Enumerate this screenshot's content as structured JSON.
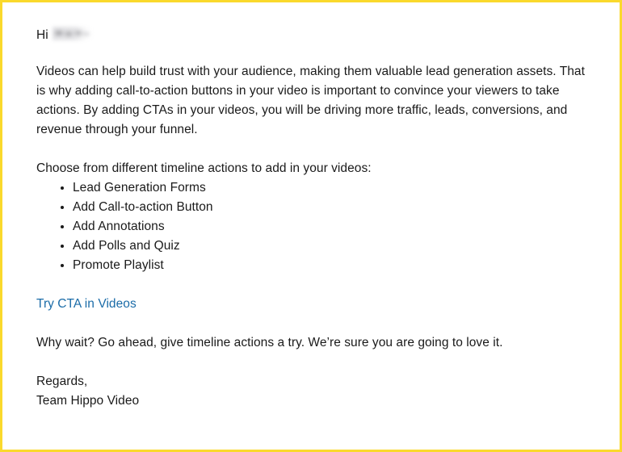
{
  "frame": {
    "border_color": "#fad92c",
    "background_color": "#ffffff",
    "text_color": "#1a1a1a"
  },
  "email": {
    "greeting": {
      "salutation": "Hi",
      "recipient_name_redacted": true
    },
    "body_paragraph": "Videos can help build trust with your audience, making them valuable lead generation assets. That is why adding call-to-action buttons in your video is important to convince your viewers to take actions. By adding CTAs in your videos, you will be driving more traffic, leads, conversions, and revenue through your funnel.",
    "list_intro": "Choose from different timeline actions to add in your videos:",
    "action_items": [
      "Lead Generation Forms",
      "Add Call-to-action Button",
      "Add Annotations",
      "Add Polls and Quiz",
      "Promote Playlist"
    ],
    "cta_link": {
      "label": "Try CTA in Videos",
      "color": "#1b6ca8"
    },
    "closing_paragraph": "Why wait? Go ahead, give timeline actions a try. We’re sure you are going to love it.",
    "signature": {
      "sign_off": "Regards,",
      "sender": "Team Hippo Video"
    }
  }
}
